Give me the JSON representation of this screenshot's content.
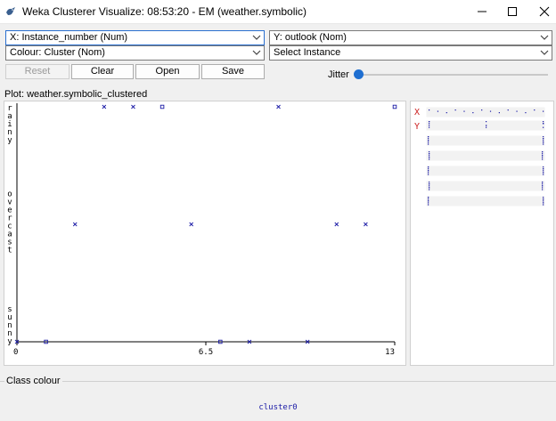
{
  "window": {
    "title": "Weka Clusterer Visualize: 08:53:20 - EM (weather.symbolic)",
    "icon": "weka-bird-icon",
    "controls": [
      "minimize-icon",
      "maximize-icon",
      "close-icon"
    ]
  },
  "controls": {
    "x_axis": "X: Instance_number (Num)",
    "y_axis": "Y: outlook (Nom)",
    "colour": "Colour: Cluster (Nom)",
    "select_instance": "Select Instance",
    "reset_label": "Reset",
    "clear_label": "Clear",
    "open_label": "Open",
    "save_label": "Save",
    "jitter_label": "Jitter",
    "jitter_value": 0
  },
  "plot": {
    "title": "Plot: weather.symbolic_clustered",
    "colors": {
      "point": "#1a1aa6",
      "axis": "#000000"
    }
  },
  "chart_data": {
    "type": "scatter",
    "x_range": [
      0,
      13
    ],
    "x_ticks": [
      "0",
      "6.5",
      "13"
    ],
    "y_categories": [
      "sunny",
      "overcast",
      "rainy"
    ],
    "points": [
      {
        "x": 0,
        "y": "sunny",
        "marker": "x"
      },
      {
        "x": 1,
        "y": "sunny",
        "marker": "square"
      },
      {
        "x": 2,
        "y": "overcast",
        "marker": "x"
      },
      {
        "x": 3,
        "y": "rainy",
        "marker": "x"
      },
      {
        "x": 4,
        "y": "rainy",
        "marker": "x"
      },
      {
        "x": 5,
        "y": "rainy",
        "marker": "square"
      },
      {
        "x": 6,
        "y": "overcast",
        "marker": "x"
      },
      {
        "x": 7,
        "y": "sunny",
        "marker": "square"
      },
      {
        "x": 8,
        "y": "sunny",
        "marker": "x"
      },
      {
        "x": 9,
        "y": "rainy",
        "marker": "x"
      },
      {
        "x": 10,
        "y": "sunny",
        "marker": "x"
      },
      {
        "x": 11,
        "y": "overcast",
        "marker": "x"
      },
      {
        "x": 12,
        "y": "overcast",
        "marker": "x"
      },
      {
        "x": 13,
        "y": "rainy",
        "marker": "square"
      }
    ]
  },
  "mini_plot": {
    "x_label": "X",
    "y_label": "Y",
    "x_color": "#cc2222",
    "y_color": "#cc2222"
  },
  "class_colour": {
    "title": "Class colour",
    "legend": [
      {
        "name": "cluster0",
        "color": "#1a1aa6"
      }
    ]
  }
}
